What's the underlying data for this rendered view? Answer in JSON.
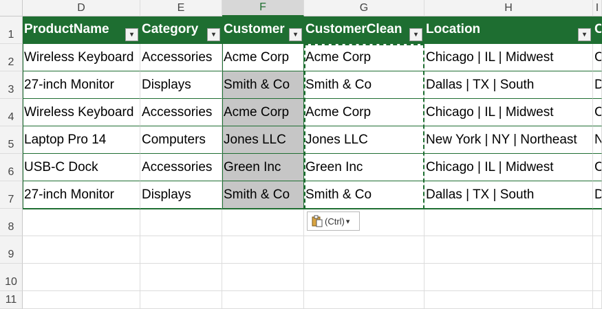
{
  "columns": [
    "D",
    "E",
    "F",
    "G",
    "H",
    "I"
  ],
  "selected_column": "F",
  "rows": [
    "1",
    "2",
    "3",
    "4",
    "5",
    "6",
    "7",
    "8",
    "9",
    "10",
    "11"
  ],
  "table": {
    "headers": [
      "ProductName",
      "Category",
      "Customer",
      "CustomerClean",
      "Location",
      "C"
    ],
    "data": [
      [
        "Wireless Keyboard",
        "Accessories",
        "Acme Corp",
        "Acme Corp",
        "Chicago | IL | Midwest",
        "C"
      ],
      [
        "27-inch Monitor",
        "Displays",
        "Smith & Co",
        "Smith & Co",
        "Dallas | TX | South",
        "D"
      ],
      [
        "Wireless Keyboard",
        "Accessories",
        "Acme Corp",
        "Acme Corp",
        "Chicago | IL | Midwest",
        "C"
      ],
      [
        "Laptop Pro 14",
        "Computers",
        "Jones LLC",
        "Jones LLC",
        "New York | NY | Northeast",
        "N"
      ],
      [
        "USB-C Dock",
        "Accessories",
        "Green Inc",
        "Green Inc",
        "Chicago | IL | Midwest",
        "C"
      ],
      [
        "27-inch Monitor",
        "Displays",
        "Smith & Co",
        "Smith & Co",
        "Dallas | TX | South",
        "D"
      ]
    ]
  },
  "paste_options": {
    "label": "(Ctrl)",
    "icon": "clipboard-icon",
    "caret": "▾"
  },
  "filter_glyph": "▾",
  "colors": {
    "table_header": "#1e6e31",
    "selection": "#c6c6c6"
  }
}
